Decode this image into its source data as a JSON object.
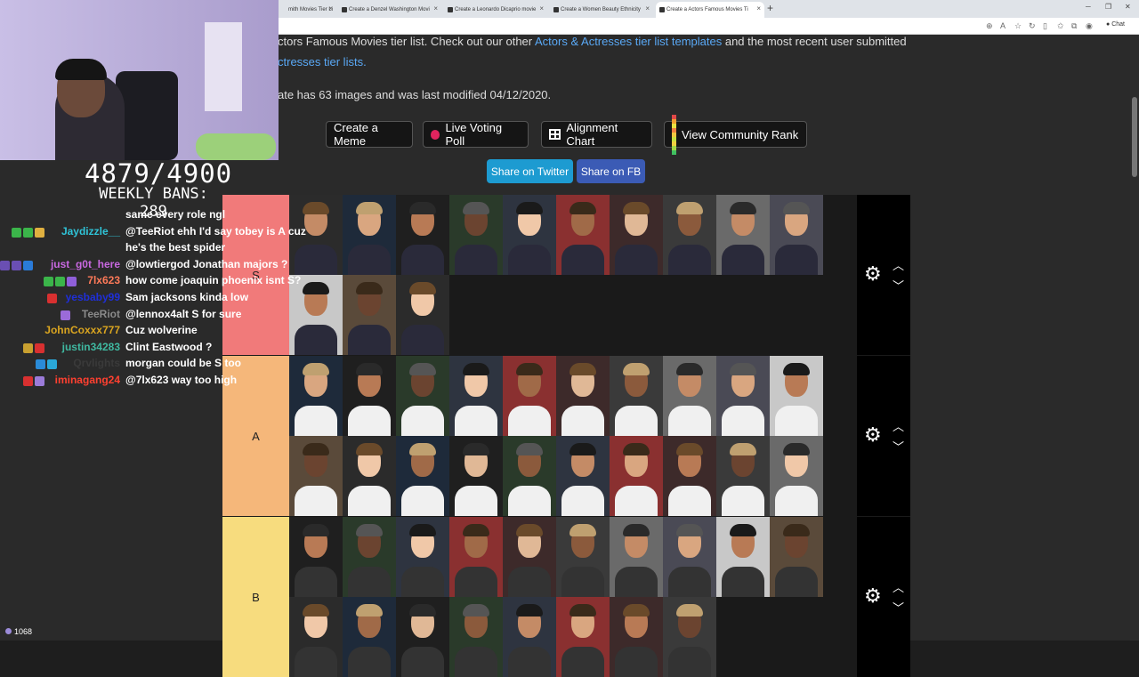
{
  "browser": {
    "tabs": [
      {
        "label": "mith Movies Tier Li",
        "active": false
      },
      {
        "label": "Create a Denzel Washington Movi",
        "active": false
      },
      {
        "label": "Create a Leonardo Dicaprio movie",
        "active": false
      },
      {
        "label": "Create a Women Beauty Ethnicity",
        "active": false
      },
      {
        "label": "Create a Actors Famous Movies Ti",
        "active": true
      }
    ],
    "new_tab": "+",
    "chat_label": "Chat"
  },
  "page": {
    "intro_line1_prefix": "ctors Famous Movies tier list. Check out our other ",
    "intro_link1": "Actors & Actresses tier list templates",
    "intro_line1_suffix": " and the most recent user submitted",
    "intro_link2": "ctresses tier lists.",
    "meta_line": "ate has 63 images and was last modified 04/12/2020.",
    "buttons": {
      "meme": "Create a Meme",
      "poll": "Live Voting Poll",
      "alignment": "Alignment Chart",
      "community": "View Community Rank"
    },
    "share": {
      "twitter": "Share on Twitter",
      "fb": "Share on FB"
    }
  },
  "tiers": [
    {
      "label": "S",
      "color": "#f17a7a",
      "rows": 2,
      "count": 13
    },
    {
      "label": "A",
      "color": "#f5b77a",
      "rows": 2,
      "count": 20
    },
    {
      "label": "B",
      "color": "#f7dc7e",
      "rows": 2,
      "count": 18
    }
  ],
  "stream": {
    "counter": "4879/4900",
    "bans": "WEEKLY BANS: 289",
    "viewers": "1068",
    "chat": [
      {
        "user": "",
        "user_color": "#ffffff",
        "msg": "same every role ngl",
        "badges": []
      },
      {
        "user": "Jaydizzle__",
        "user_color": "#2fc3d7",
        "msg": "@TeeRiot ehh I'd say tobey is A cuz",
        "badges": [
          "#3bb54a",
          "#3bb54a",
          "#e0b040"
        ]
      },
      {
        "user": "",
        "user_color": "#ffffff",
        "msg": "he's the best spider",
        "badges": []
      },
      {
        "user": "just_g0t_here",
        "user_color": "#c868e0",
        "msg": "@lowtiergod Jonathan majors ?",
        "badges": [
          "#6a4fb3",
          "#6a4fb3",
          "#2a7bd8"
        ]
      },
      {
        "user": "7lx623",
        "user_color": "#ff7a59",
        "msg": "how come joaquin phoenix isnt S?",
        "badges": [
          "#3bb54a",
          "#3bb54a",
          "#8f5fd9"
        ]
      },
      {
        "user": "yesbaby99",
        "user_color": "#1f2fd8",
        "msg": "Sam jacksons kinda low",
        "badges": [
          "#d83030"
        ]
      },
      {
        "user": "TeeRiot",
        "user_color": "#8a8a8a",
        "msg": "@lennox4alt S for sure",
        "badges": [
          "#9b6bd9"
        ]
      },
      {
        "user": "JohnCoxxx777",
        "user_color": "#daa520",
        "msg": "Cuz wolverine",
        "badges": []
      },
      {
        "user": "justin34283",
        "user_color": "#3fb8a0",
        "msg": "Clint Eastwood ?",
        "badges": [
          "#c8a030",
          "#d83030"
        ]
      },
      {
        "user": "Qrvlights",
        "user_color": "#3a3a3a",
        "msg": "morgan could be S too",
        "badges": [
          "#2a8bd8",
          "#2aa8d8"
        ]
      },
      {
        "user": "iminagang24",
        "user_color": "#ff4030",
        "msg": "@7lx623 way too high",
        "badges": [
          "#d83030",
          "#9b7bd9"
        ]
      }
    ]
  }
}
